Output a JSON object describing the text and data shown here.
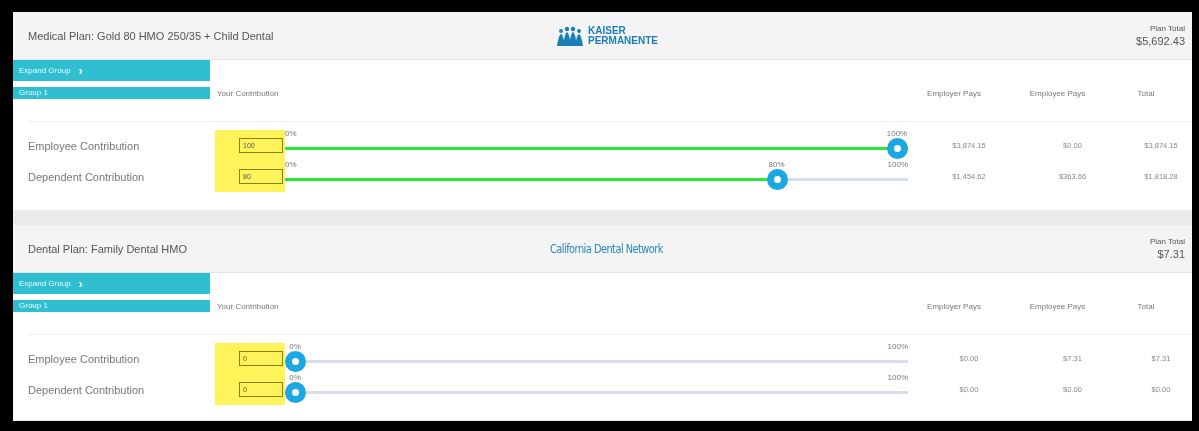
{
  "plans": [
    {
      "title": "Medical Plan: Gold 80 HMO 250/35 + Child Dental",
      "logo": {
        "kind": "kaiser",
        "lines": [
          "KAISER",
          "PERMANENTE"
        ]
      },
      "total_label": "Plan Total",
      "total": "$5,692.43",
      "expand_label": "Expand Group",
      "expand_icon": "›",
      "group": "Group 1",
      "columns": [
        "Your Contribution",
        "Employer Pays",
        "Employee Pays",
        "Total"
      ],
      "rows": [
        {
          "label": "Employee Contribution",
          "value": "100",
          "level": 1,
          "min_label": "0%",
          "thumb_label": "100%",
          "employer": "$3,874.15",
          "employee": "$0.00",
          "total": "$3,874.15"
        },
        {
          "label": "Dependent Contribution",
          "value": "80",
          "level": 0.8,
          "min_label": "0%",
          "thumb_label": "80%",
          "max_label": "100%",
          "employer": "$1,454.62",
          "employee": "$363.66",
          "total": "$1,818.28"
        }
      ]
    },
    {
      "title": "Dental Plan: Family Dental HMO",
      "logo": {
        "kind": "wordmark",
        "lines": [
          "California Dental Network"
        ]
      },
      "total_label": "Plan Total",
      "total": "$7.31",
      "expand_label": "Expand Group",
      "expand_icon": "›",
      "group": "Group 1",
      "columns": [
        "Your Contribution",
        "Employer Pays",
        "Employee Pays",
        "Total"
      ],
      "rows": [
        {
          "label": "Employee Contribution",
          "value": "0",
          "level": 0,
          "thumb_label": "0%",
          "max_label": "100%",
          "employer": "$0.00",
          "employee": "$7.31",
          "total": "$7.31"
        },
        {
          "label": "Dependent Contribution",
          "value": "0",
          "level": 0,
          "thumb_label": "0%",
          "max_label": "100%",
          "employer": "$0.00",
          "employee": "$0.00",
          "total": "$0.00"
        }
      ]
    }
  ]
}
